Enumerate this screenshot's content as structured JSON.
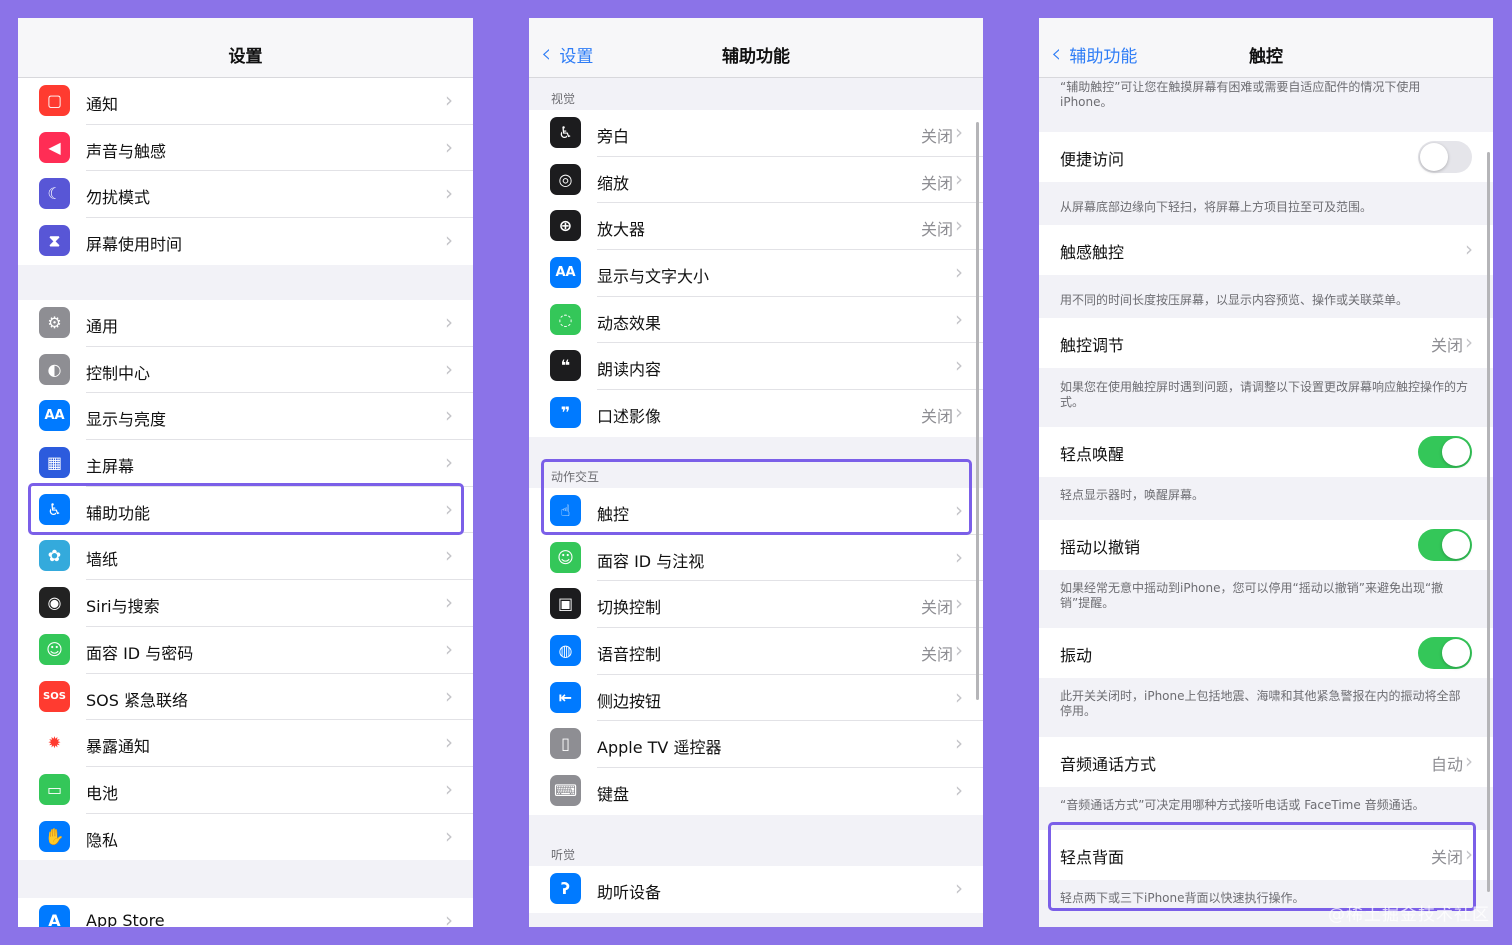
{
  "panel1": {
    "title": "设置",
    "group1": [
      {
        "label": "通知",
        "icon": "notification-icon",
        "color": "#ff3b30"
      },
      {
        "label": "声音与触感",
        "icon": "speaker-icon",
        "color": "#ff2d55"
      },
      {
        "label": "勿扰模式",
        "icon": "moon-icon",
        "color": "#5856d6"
      },
      {
        "label": "屏幕使用时间",
        "icon": "hourglass-icon",
        "color": "#5856d6"
      }
    ],
    "group2": [
      {
        "label": "通用",
        "icon": "gear-icon",
        "color": "#8e8e93"
      },
      {
        "label": "控制中心",
        "icon": "toggles-icon",
        "color": "#8e8e93"
      },
      {
        "label": "显示与亮度",
        "icon": "text-size-icon",
        "color": "#007aff"
      },
      {
        "label": "主屏幕",
        "icon": "grid-icon",
        "color": "#2c5bdd"
      },
      {
        "label": "辅助功能",
        "icon": "accessibility-icon",
        "color": "#007aff"
      },
      {
        "label": "墙纸",
        "icon": "flower-icon",
        "color": "#34aadc"
      },
      {
        "label": "Siri与搜索",
        "icon": "siri-icon",
        "color": "#222222"
      },
      {
        "label": "面容 ID 与密码",
        "icon": "face-id-icon",
        "color": "#34c759"
      },
      {
        "label": "SOS 紧急联络",
        "icon": "sos-icon",
        "color": "#ff3b30"
      },
      {
        "label": "暴露通知",
        "icon": "exposure-icon",
        "color": "#ffffff"
      },
      {
        "label": "电池",
        "icon": "battery-icon",
        "color": "#34c759"
      },
      {
        "label": "隐私",
        "icon": "hand-icon",
        "color": "#007aff"
      }
    ],
    "group3": [
      {
        "label": "App Store",
        "icon": "app-store-icon",
        "color": "#007aff"
      }
    ]
  },
  "panel2": {
    "back": "设置",
    "title": "辅助功能",
    "sections": [
      {
        "header": "视觉",
        "items": [
          {
            "label": "旁白",
            "value": "关闭",
            "icon": "voiceover-icon",
            "color": "#1c1c1e"
          },
          {
            "label": "缩放",
            "value": "关闭",
            "icon": "zoom-icon",
            "color": "#1c1c1e"
          },
          {
            "label": "放大器",
            "value": "关闭",
            "icon": "magnifier-icon",
            "color": "#1c1c1e"
          },
          {
            "label": "显示与文字大小",
            "value": "",
            "icon": "text-size-icon",
            "color": "#007aff"
          },
          {
            "label": "动态效果",
            "value": "",
            "icon": "motion-icon",
            "color": "#34c759"
          },
          {
            "label": "朗读内容",
            "value": "",
            "icon": "speech-icon",
            "color": "#1c1c1e"
          },
          {
            "label": "口述影像",
            "value": "关闭",
            "icon": "audio-description-icon",
            "color": "#007aff"
          }
        ]
      },
      {
        "header": "动作交互",
        "items": [
          {
            "label": "触控",
            "value": "",
            "icon": "touch-icon",
            "color": "#007aff"
          },
          {
            "label": "面容 ID 与注视",
            "value": "",
            "icon": "face-id-icon",
            "color": "#34c759"
          },
          {
            "label": "切换控制",
            "value": "关闭",
            "icon": "switch-control-icon",
            "color": "#1c1c1e"
          },
          {
            "label": "语音控制",
            "value": "关闭",
            "icon": "voice-control-icon",
            "color": "#007aff"
          },
          {
            "label": "侧边按钮",
            "value": "",
            "icon": "side-button-icon",
            "color": "#007aff"
          },
          {
            "label": "Apple TV 遥控器",
            "value": "",
            "icon": "remote-icon",
            "color": "#8e8e93"
          },
          {
            "label": "键盘",
            "value": "",
            "icon": "keyboard-icon",
            "color": "#8e8e93"
          }
        ]
      },
      {
        "header": "听觉",
        "items": [
          {
            "label": "助听设备",
            "value": "",
            "icon": "ear-icon",
            "color": "#007aff"
          }
        ]
      }
    ]
  },
  "panel3": {
    "back": "辅助功能",
    "title": "触控",
    "intro": "“辅助触控”可让您在触摸屏幕有困难或需要自适应配件的情况下使用 iPhone。",
    "settings": [
      {
        "label": "便捷访问",
        "value": "",
        "toggle": false,
        "footer": "从屏幕底部边缘向下轻扫，将屏幕上方项目拉至可及范围。"
      },
      {
        "label": "触感触控",
        "value": "",
        "toggle": null,
        "footer": "用不同的时间长度按压屏幕，以显示内容预览、操作或关联菜单。"
      },
      {
        "label": "触控调节",
        "value": "关闭",
        "toggle": null,
        "footer": "如果您在使用触控屏时遇到问题，请调整以下设置更改屏幕响应触控操作的方式。"
      },
      {
        "label": "轻点唤醒",
        "value": "",
        "toggle": true,
        "footer": "轻点显示器时，唤醒屏幕。"
      },
      {
        "label": "摇动以撤销",
        "value": "",
        "toggle": true,
        "footer": "如果经常无意中摇动到iPhone，您可以停用“摇动以撤销”来避免出现“撤销”提醒。"
      },
      {
        "label": "振动",
        "value": "",
        "toggle": true,
        "footer": "此开关关闭时，iPhone上包括地震、海啸和其他紧急警报在内的振动将全部停用。"
      },
      {
        "label": "音频通话方式",
        "value": "自动",
        "toggle": null,
        "footer": "“音频通话方式”可决定用哪种方式接听电话或 FaceTime 音频通话。"
      },
      {
        "label": "轻点背面",
        "value": "关闭",
        "toggle": null,
        "footer": "轻点两下或三下iPhone背面以快速执行操作。"
      }
    ]
  },
  "watermark": "@稀土掘金技术社区",
  "highlight_color": "#7b5fe8"
}
